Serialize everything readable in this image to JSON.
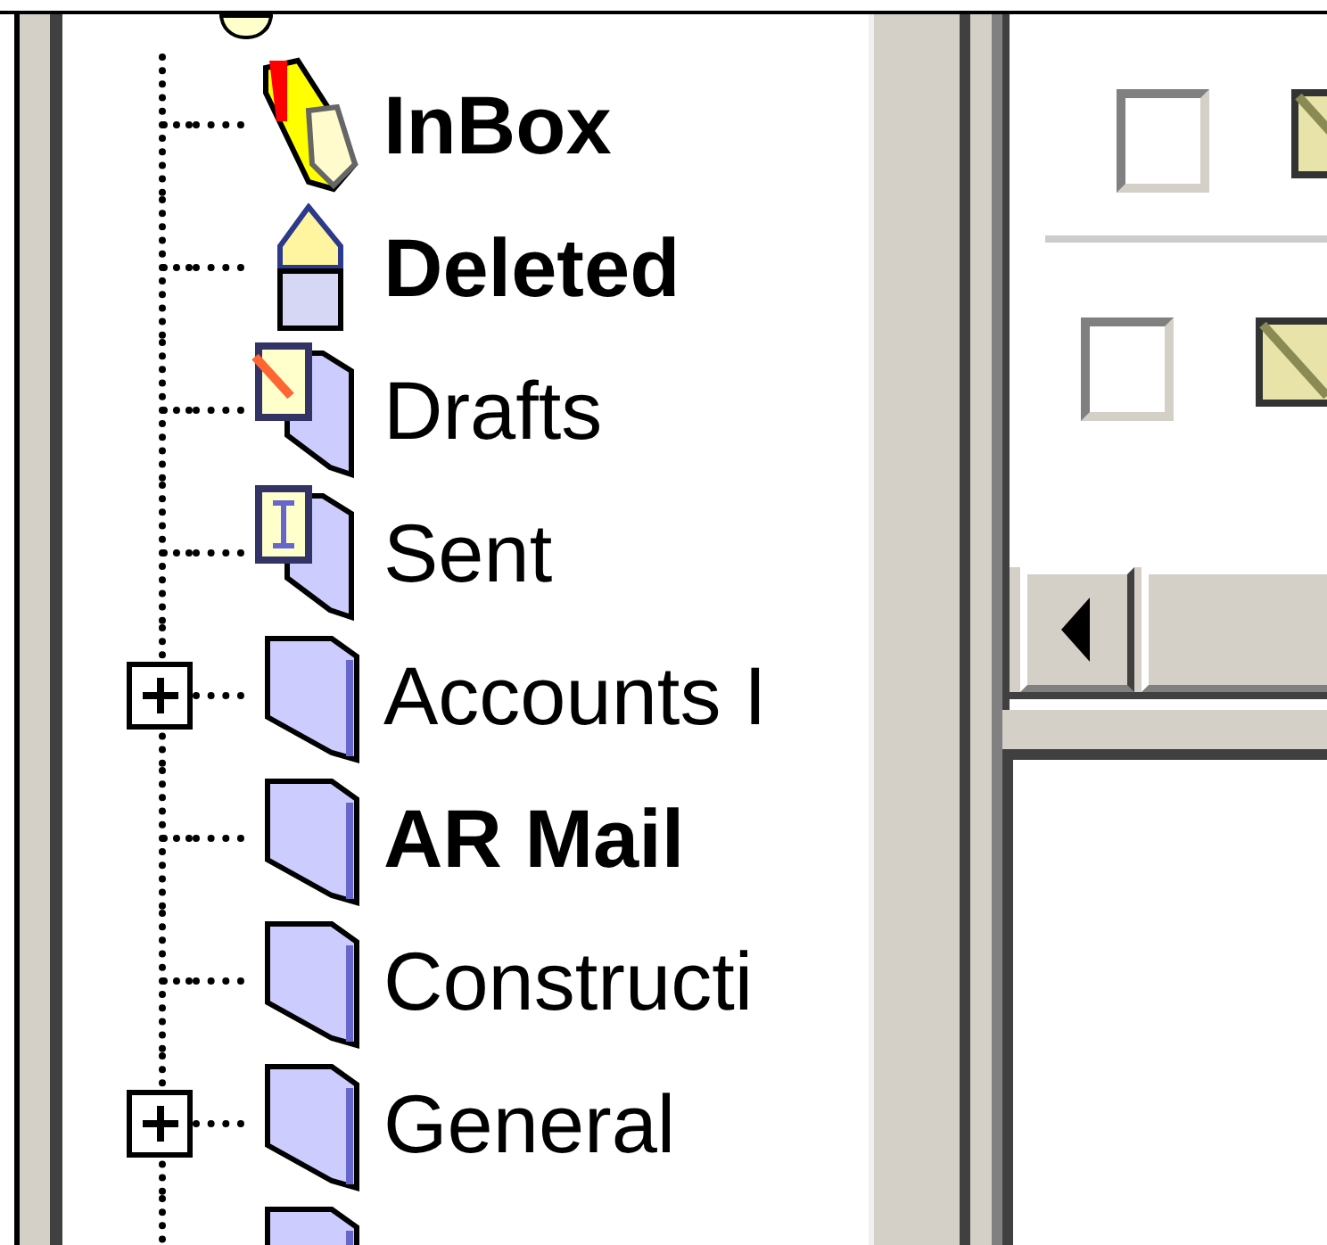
{
  "folders": [
    {
      "label": "InBox",
      "kind": "inbox",
      "unread": true
    },
    {
      "label": "Deleted",
      "kind": "deleted",
      "unread": true
    },
    {
      "label": "Drafts",
      "kind": "drafts",
      "unread": false
    },
    {
      "label": "Sent",
      "kind": "sent",
      "unread": false
    },
    {
      "label": "Accounts I",
      "kind": "folder",
      "unread": false,
      "expanded": false
    },
    {
      "label": "AR Mail",
      "kind": "folder",
      "unread": true
    },
    {
      "label": "Constructi",
      "kind": "folder",
      "unread": false
    },
    {
      "label": "General",
      "kind": "folder",
      "unread": false,
      "expanded": false
    },
    {
      "kind": "folder"
    }
  ],
  "messages": [
    {
      "checked": false
    },
    {
      "checked": false
    }
  ]
}
